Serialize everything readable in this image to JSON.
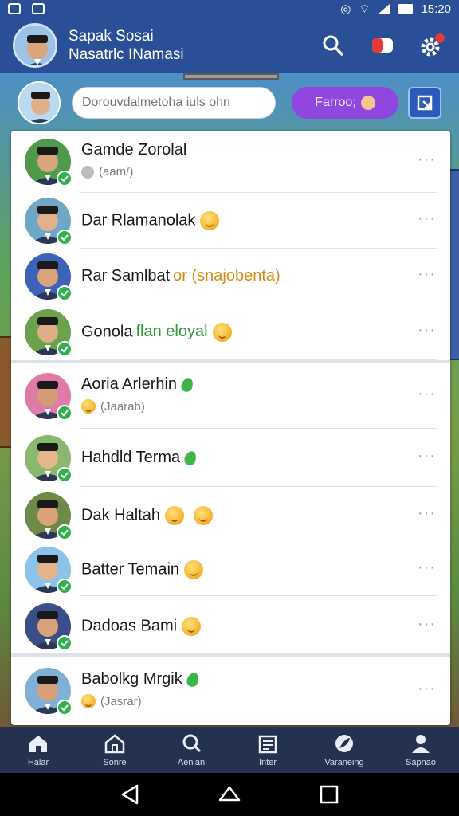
{
  "status_bar": {
    "time": "15:20"
  },
  "header": {
    "title_line1": "Sapak Sosai",
    "title_line2": "Nasatrlc INamasi"
  },
  "composer": {
    "placeholder": "Dorouvdalmetoha iuls ohn",
    "pill_label": "Farroo;"
  },
  "contacts": [
    {
      "name": "Gamde Zorolal",
      "subtitle": "(aam/)",
      "status": "sticker-grey"
    },
    {
      "name": "Dar Rlamanolak",
      "emoji": true
    },
    {
      "name": "Rar Samlbat",
      "tag": "or (snajobenta)",
      "tag_color": "#d48a14"
    },
    {
      "name": "Gonola",
      "tag": "flan eloyal",
      "tag_color": "#2e9a34",
      "emoji": true
    },
    {
      "name": "Aoria Arlerhin",
      "subtitle": "(Jaarah)",
      "status": "emoji",
      "leaf": true
    },
    {
      "name": "Hahdld Terma",
      "leaf": true
    },
    {
      "name": "Dak Haltah",
      "emoji": true,
      "emoji2": true
    },
    {
      "name": "Batter Temain",
      "emoji": true
    },
    {
      "name": "Dadoas Bami",
      "emoji": true
    },
    {
      "name": "Babolkg Mrgik",
      "subtitle": "(Jasrar)",
      "status": "emoji",
      "leaf": true
    }
  ],
  "tabs": [
    {
      "label": "Halar",
      "icon": "home-icon"
    },
    {
      "label": "Sonre",
      "icon": "house-outline-icon"
    },
    {
      "label": "Aenian",
      "icon": "search-icon"
    },
    {
      "label": "Inter",
      "icon": "calendar-icon"
    },
    {
      "label": "Varaneing",
      "icon": "leaf-icon"
    },
    {
      "label": "Sapnao",
      "icon": "person-icon"
    }
  ],
  "colors": {
    "header_bg": "#2a4f96",
    "accent_purple": "#8f47e0",
    "online_green": "#2fb24c",
    "tabbar_bg": "#24324f"
  }
}
